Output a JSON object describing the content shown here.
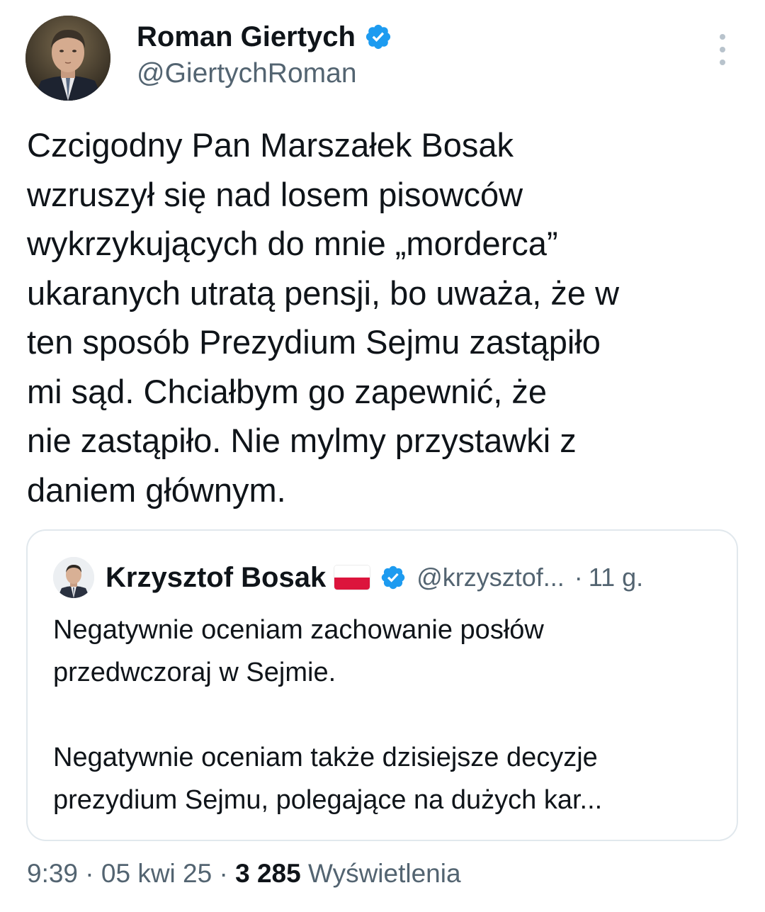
{
  "author": {
    "name": "Roman Giertych",
    "handle": "@GiertychRoman",
    "verified": true
  },
  "tweet": {
    "lines": [
      "Czcigodny Pan Marszałek Bosak",
      "wzruszył się nad losem pisowców",
      "wykrzykujących do mnie „morderca”",
      "ukaranych utratą pensji, bo uważa, że w",
      "ten sposób Prezydium Sejmu zastąpiło",
      "mi sąd. Chciałbym go zapewnić, że",
      "nie zastąpiło. Nie mylmy przystawki z",
      "daniem głównym."
    ]
  },
  "quote": {
    "name": "Krzysztof Bosak",
    "flag_icon": "poland-flag-icon",
    "verified": true,
    "handle": "@krzysztof...",
    "separator": "·",
    "time": "11 g.",
    "para1": [
      "Negatywnie oceniam zachowanie posłów",
      "przedwczoraj w Sejmie."
    ],
    "para2": [
      "Negatywnie oceniam także dzisiejsze decyzje",
      "prezydium Sejmu, polegające na dużych kar..."
    ]
  },
  "meta": {
    "time": "9:39",
    "sep1": "·",
    "date": "05 kwi 25",
    "sep2": "·",
    "views_count": "3 285",
    "views_label": "Wyświetlenia"
  },
  "colors": {
    "text": "#0f1419",
    "secondary": "#536471",
    "verified_blue": "#1d9bf0",
    "border": "#e1e8ed"
  }
}
